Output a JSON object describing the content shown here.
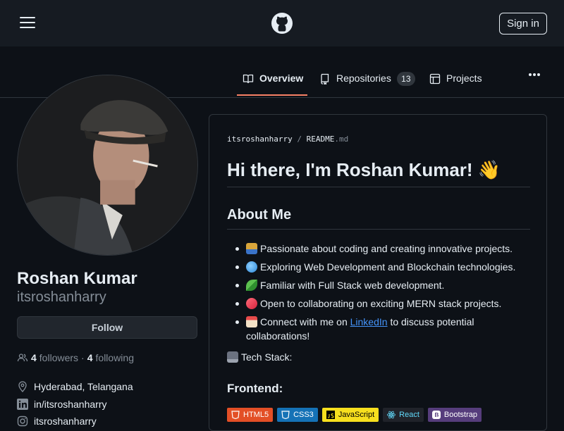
{
  "header": {
    "sign_in_label": "Sign in",
    "logo_icon": "github-logo-icon",
    "menu_icon": "hamburger-icon"
  },
  "tabs": {
    "overview": "Overview",
    "repositories": "Repositories",
    "repositories_count": "13",
    "projects": "Projects"
  },
  "profile": {
    "name": "Roshan Kumar",
    "username": "itsroshanharry",
    "follow_label": "Follow",
    "followers_count": "4",
    "followers_label": "followers",
    "separator": "·",
    "following_count": "4",
    "following_label": "following",
    "location": "Hyderabad, Telangana",
    "linkedin": "in/itsroshanharry",
    "instagram": "itsroshanharry"
  },
  "readme": {
    "path_user": "itsroshanharry",
    "path_separator": "/",
    "path_file": "README",
    "path_ext": ".md",
    "title": "Hi there, I'm Roshan Kumar! 👋",
    "about_heading": "About Me",
    "about_items": [
      "Passionate about coding and creating innovative projects.",
      "Exploring Web Development and Blockchain technologies.",
      "Familiar with Full Stack web development.",
      "Open to collaborating on exciting MERN stack projects."
    ],
    "connect_before": "Connect with me on ",
    "connect_link": "LinkedIn",
    "connect_after": " to discuss potential collaborations!",
    "tech_stack": "Tech Stack:",
    "frontend_heading": "Frontend:",
    "badges": [
      "HTML5",
      "CSS3",
      "JavaScript",
      "React",
      "Bootstrap"
    ]
  },
  "colors": {
    "background": "#0d1117",
    "topbar": "#161b22",
    "accent_underline": "#f78166",
    "link": "#4493f8",
    "html5": "#e34f26",
    "css3": "#1572b6",
    "javascript": "#f7df1e",
    "react": "#20232a",
    "bootstrap": "#563d7c"
  }
}
